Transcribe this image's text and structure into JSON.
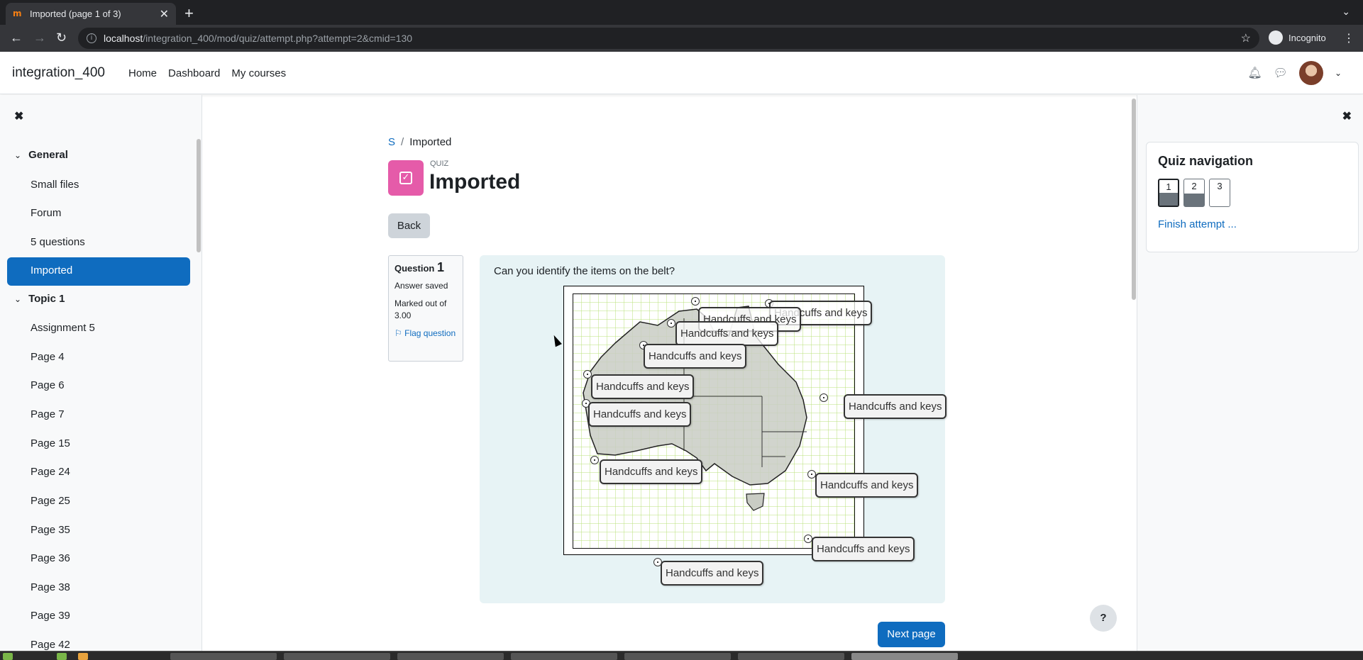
{
  "browser": {
    "tab_title": "Imported (page 1 of 3)",
    "url_host": "localhost",
    "url_path": "/integration_400/mod/quiz/attempt.php?attempt=2&cmid=130",
    "profile_label": "Incognito"
  },
  "header": {
    "site_name": "integration_400",
    "nav": [
      "Home",
      "Dashboard",
      "My courses"
    ]
  },
  "course_index": {
    "sections": [
      {
        "label": "General",
        "items": [
          "Small files",
          "Forum",
          "5 questions",
          "Imported"
        ]
      },
      {
        "label": "Topic 1",
        "items": [
          "Assignment 5",
          "Page 4",
          "Page 6",
          "Page 7",
          "Page 15",
          "Page 24",
          "Page 25",
          "Page 35",
          "Page 36",
          "Page 38",
          "Page 39",
          "Page 42"
        ]
      }
    ],
    "active_item": "Imported"
  },
  "breadcrumb": {
    "course": "S",
    "separator": "/",
    "current": "Imported"
  },
  "activity": {
    "type_label": "QUIZ",
    "title": "Imported",
    "back_label": "Back"
  },
  "question": {
    "label": "Question",
    "number": "1",
    "state": "Answer saved",
    "grade": "Marked out of 3.00",
    "flag": "Flag question",
    "text": "Can you identify the items on the belt?",
    "drag_label": "Handcuffs and keys"
  },
  "quiz_nav": {
    "title": "Quiz navigation",
    "buttons": [
      "1",
      "2",
      "3"
    ],
    "finish_label": "Finish attempt ..."
  },
  "footer": {
    "next_label": "Next page",
    "help_label": "?"
  }
}
